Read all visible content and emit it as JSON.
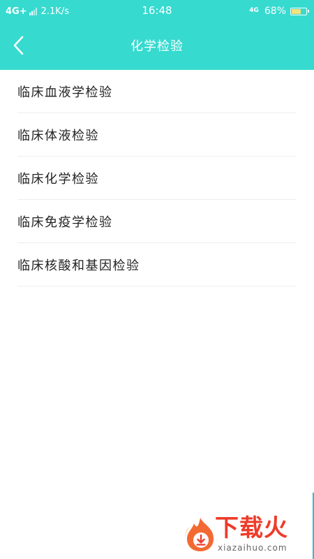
{
  "status_bar": {
    "network": "4G+",
    "speed": "2.1K/s",
    "time": "16:48",
    "network_secondary": "4G",
    "battery_text": "68%",
    "battery_level": 0.68,
    "battery_color": "#f4e27a"
  },
  "header": {
    "title": "化学检验",
    "background_color": "#36dacf",
    "back_icon": "chevron-left-icon"
  },
  "list": {
    "items": [
      {
        "label": "临床血液学检验"
      },
      {
        "label": "临床体液检验"
      },
      {
        "label": "临床化学检验"
      },
      {
        "label": "临床免疫学检验"
      },
      {
        "label": "临床核酸和基因检验"
      }
    ]
  },
  "watermark": {
    "text": "下载火",
    "url": "xiazaihuo.com",
    "color": "#ee3b2a",
    "icon": "flame-download-icon"
  }
}
